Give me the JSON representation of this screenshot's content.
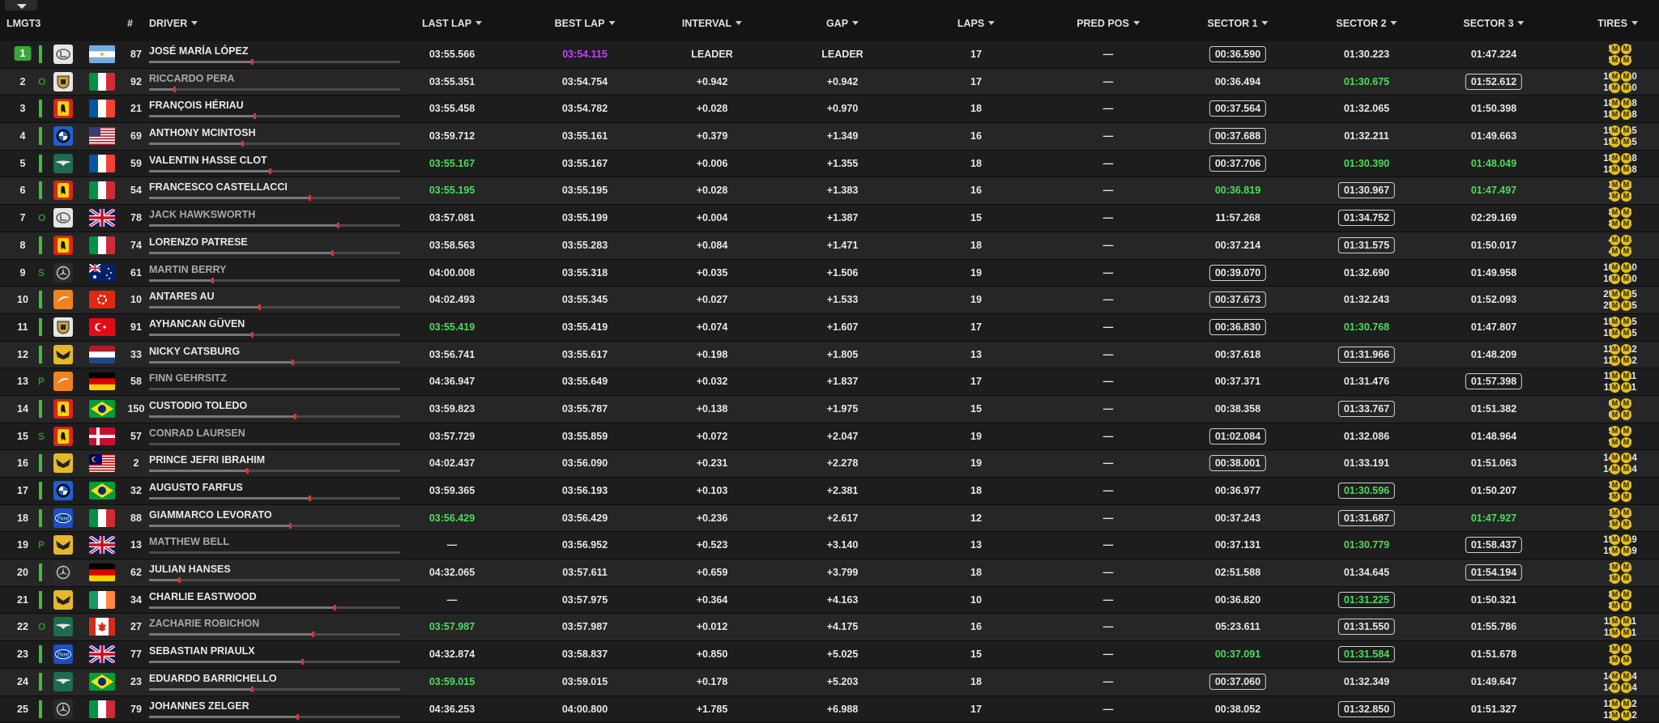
{
  "class_label": "LMGT3",
  "headers": {
    "no": "#",
    "driver": "DRIVER",
    "last_lap": "LAST LAP",
    "best_lap": "BEST LAP",
    "interval": "INTERVAL",
    "gap": "GAP",
    "laps": "LAPS",
    "pred_pos": "PRED POS",
    "sector1": "SECTOR 1",
    "sector2": "SECTOR 2",
    "sector3": "SECTOR 3",
    "tires": "TIRES"
  },
  "colors": {
    "green": "#4ddc5a",
    "purple": "#c040ff",
    "leader_badge": "#3aa63a",
    "tire": "#e8c018"
  },
  "rows": [
    {
      "pos": "1",
      "status": "",
      "brand": "lexus-icon",
      "flag": "ar",
      "no": "87",
      "driver": "JOSÉ MARÍA LÓPEZ",
      "grey": false,
      "progress": 0.41,
      "last": "03:55.566",
      "last_c": "",
      "best": "03:54.115",
      "best_c": "purple",
      "interval": "LEADER",
      "gap": "LEADER",
      "laps": "17",
      "pred": "—",
      "s1": "00:36.590",
      "s1_c": "",
      "s1_b": true,
      "s2": "01:30.223",
      "s2_c": "",
      "s2_b": false,
      "s3": "01:47.224",
      "s3_c": "",
      "s3_b": false,
      "t": [
        "5",
        "5",
        "5",
        "5"
      ]
    },
    {
      "pos": "2",
      "status": "O",
      "brand": "porsche-icon",
      "flag": "it",
      "no": "92",
      "driver": "RICCARDO PERA",
      "grey": true,
      "progress": 0.1,
      "last": "03:55.351",
      "last_c": "",
      "best": "03:54.754",
      "best_c": "",
      "interval": "+0.942",
      "gap": "+0.942",
      "laps": "17",
      "pred": "—",
      "s1": "00:36.494",
      "s1_c": "",
      "s1_b": false,
      "s2": "01:30.675",
      "s2_c": "green",
      "s2_b": false,
      "s3": "01:52.612",
      "s3_c": "",
      "s3_b": true,
      "t": [
        "10",
        "10",
        "10",
        "10"
      ]
    },
    {
      "pos": "3",
      "status": "",
      "brand": "ferrari-icon",
      "flag": "fr",
      "no": "21",
      "driver": "FRANÇOIS HÉRIAU",
      "grey": false,
      "progress": 0.42,
      "last": "03:55.458",
      "last_c": "",
      "best": "03:54.782",
      "best_c": "",
      "interval": "+0.028",
      "gap": "+0.970",
      "laps": "18",
      "pred": "—",
      "s1": "00:37.564",
      "s1_c": "",
      "s1_b": true,
      "s2": "01:32.065",
      "s2_c": "",
      "s2_b": false,
      "s3": "01:50.398",
      "s3_c": "",
      "s3_b": false,
      "t": [
        "18",
        "18",
        "18",
        "18"
      ]
    },
    {
      "pos": "4",
      "status": "",
      "brand": "bmw-icon",
      "flag": "us",
      "no": "69",
      "driver": "ANTHONY MCINTOSH",
      "grey": false,
      "progress": 0.37,
      "last": "03:59.712",
      "last_c": "",
      "best": "03:55.161",
      "best_c": "",
      "interval": "+0.379",
      "gap": "+1.349",
      "laps": "16",
      "pred": "—",
      "s1": "00:37.688",
      "s1_c": "",
      "s1_b": true,
      "s2": "01:32.211",
      "s2_c": "",
      "s2_b": false,
      "s3": "01:49.663",
      "s3_c": "",
      "s3_b": false,
      "t": [
        "15",
        "15",
        "15",
        "15"
      ]
    },
    {
      "pos": "5",
      "status": "",
      "brand": "aston-martin-icon",
      "flag": "fr",
      "no": "59",
      "driver": "VALENTIN HASSE CLOT",
      "grey": false,
      "progress": 0.48,
      "last": "03:55.167",
      "last_c": "green",
      "best": "03:55.167",
      "best_c": "",
      "interval": "+0.006",
      "gap": "+1.355",
      "laps": "18",
      "pred": "—",
      "s1": "00:37.706",
      "s1_c": "",
      "s1_b": true,
      "s2": "01:30.390",
      "s2_c": "green",
      "s2_b": false,
      "s3": "01:48.049",
      "s3_c": "green",
      "s3_b": false,
      "t": [
        "18",
        "18",
        "18",
        "18"
      ]
    },
    {
      "pos": "6",
      "status": "",
      "brand": "ferrari-icon",
      "flag": "it",
      "no": "54",
      "driver": "FRANCESCO CASTELLACCI",
      "grey": false,
      "progress": 0.64,
      "last": "03:55.195",
      "last_c": "green",
      "best": "03:55.195",
      "best_c": "",
      "interval": "+0.028",
      "gap": "+1.383",
      "laps": "16",
      "pred": "—",
      "s1": "00:36.819",
      "s1_c": "green",
      "s1_b": false,
      "s2": "01:30.967",
      "s2_c": "",
      "s2_b": true,
      "s3": "01:47.497",
      "s3_c": "green",
      "s3_b": false,
      "t": [
        "2",
        "2",
        "2",
        "2"
      ]
    },
    {
      "pos": "7",
      "status": "O",
      "brand": "lexus-icon",
      "flag": "gb",
      "no": "78",
      "driver": "JACK HAWKSWORTH",
      "grey": true,
      "progress": 0.75,
      "last": "03:57.081",
      "last_c": "",
      "best": "03:55.199",
      "best_c": "",
      "interval": "+0.004",
      "gap": "+1.387",
      "laps": "15",
      "pred": "—",
      "s1": "11:57.268",
      "s1_c": "",
      "s1_b": false,
      "s2": "01:34.752",
      "s2_c": "",
      "s2_b": true,
      "s3": "02:29.169",
      "s3_c": "",
      "s3_b": false,
      "t": [
        "8",
        "8",
        "8",
        "8"
      ]
    },
    {
      "pos": "8",
      "status": "",
      "brand": "ferrari-icon",
      "flag": "it",
      "no": "74",
      "driver": "LORENZO PATRESE",
      "grey": false,
      "progress": 0.73,
      "last": "03:58.563",
      "last_c": "",
      "best": "03:55.283",
      "best_c": "",
      "interval": "+0.084",
      "gap": "+1.471",
      "laps": "18",
      "pred": "—",
      "s1": "00:37.214",
      "s1_c": "",
      "s1_b": false,
      "s2": "01:31.575",
      "s2_c": "",
      "s2_b": true,
      "s3": "01:50.017",
      "s3_c": "",
      "s3_b": false,
      "t": [
        "4",
        "4",
        "4",
        "4"
      ]
    },
    {
      "pos": "9",
      "status": "S",
      "brand": "mercedes-icon",
      "flag": "au",
      "no": "61",
      "driver": "MARTIN BERRY",
      "grey": true,
      "progress": 0.25,
      "last": "04:00.008",
      "last_c": "",
      "best": "03:55.318",
      "best_c": "",
      "interval": "+0.035",
      "gap": "+1.506",
      "laps": "19",
      "pred": "—",
      "s1": "00:39.070",
      "s1_c": "",
      "s1_b": true,
      "s2": "01:32.690",
      "s2_c": "",
      "s2_b": false,
      "s3": "01:49.958",
      "s3_c": "",
      "s3_b": false,
      "t": [
        "10",
        "10",
        "10",
        "10"
      ]
    },
    {
      "pos": "10",
      "status": "",
      "brand": "mclaren-icon",
      "flag": "hk",
      "no": "10",
      "driver": "ANTARES AU",
      "grey": false,
      "progress": 0.44,
      "last": "04:02.493",
      "last_c": "",
      "best": "03:55.345",
      "best_c": "",
      "interval": "+0.027",
      "gap": "+1.533",
      "laps": "19",
      "pred": "—",
      "s1": "00:37.673",
      "s1_c": "",
      "s1_b": true,
      "s2": "01:32.243",
      "s2_c": "",
      "s2_b": false,
      "s3": "01:52.093",
      "s3_c": "",
      "s3_b": false,
      "t": [
        "25",
        "25",
        "25",
        "25"
      ]
    },
    {
      "pos": "11",
      "status": "",
      "brand": "porsche-icon",
      "flag": "tr",
      "no": "91",
      "driver": "AYHANCAN GÜVEN",
      "grey": false,
      "progress": 0.41,
      "last": "03:55.419",
      "last_c": "green",
      "best": "03:55.419",
      "best_c": "",
      "interval": "+0.074",
      "gap": "+1.607",
      "laps": "17",
      "pred": "—",
      "s1": "00:36.830",
      "s1_c": "",
      "s1_b": true,
      "s2": "01:30.768",
      "s2_c": "green",
      "s2_b": false,
      "s3": "01:47.807",
      "s3_c": "",
      "s3_b": false,
      "t": [
        "15",
        "15",
        "15",
        "15"
      ]
    },
    {
      "pos": "12",
      "status": "",
      "brand": "corvette-icon",
      "flag": "nl",
      "no": "33",
      "driver": "NICKY CATSBURG",
      "grey": false,
      "progress": 0.57,
      "last": "03:56.741",
      "last_c": "",
      "best": "03:55.617",
      "best_c": "",
      "interval": "+0.198",
      "gap": "+1.805",
      "laps": "13",
      "pred": "—",
      "s1": "00:37.618",
      "s1_c": "",
      "s1_b": false,
      "s2": "01:31.966",
      "s2_c": "",
      "s2_b": true,
      "s3": "01:48.209",
      "s3_c": "",
      "s3_b": false,
      "t": [
        "12",
        "12",
        "12",
        "12"
      ]
    },
    {
      "pos": "13",
      "status": "P",
      "brand": "mclaren-icon",
      "flag": "de",
      "no": "58",
      "driver": "FINN GEHRSITZ",
      "grey": true,
      "progress": 0.0,
      "last": "04:36.947",
      "last_c": "",
      "best": "03:55.649",
      "best_c": "",
      "interval": "+0.032",
      "gap": "+1.837",
      "laps": "17",
      "pred": "—",
      "s1": "00:37.371",
      "s1_c": "",
      "s1_b": false,
      "s2": "01:31.476",
      "s2_c": "",
      "s2_b": false,
      "s3": "01:57.398",
      "s3_c": "",
      "s3_b": true,
      "t": [
        "11",
        "11",
        "11",
        "11"
      ]
    },
    {
      "pos": "14",
      "status": "",
      "brand": "ferrari-icon",
      "flag": "br",
      "no": "150",
      "driver": "CUSTODIO TOLEDO",
      "grey": false,
      "progress": 0.58,
      "last": "03:59.823",
      "last_c": "",
      "best": "03:55.787",
      "best_c": "",
      "interval": "+0.138",
      "gap": "+1.975",
      "laps": "15",
      "pred": "—",
      "s1": "00:38.358",
      "s1_c": "",
      "s1_b": false,
      "s2": "01:33.767",
      "s2_c": "",
      "s2_b": true,
      "s3": "01:51.382",
      "s3_c": "",
      "s3_b": false,
      "t": [
        "6",
        "6",
        "6",
        "6"
      ]
    },
    {
      "pos": "15",
      "status": "S",
      "brand": "ferrari-icon",
      "flag": "dk",
      "no": "57",
      "driver": "CONRAD LAURSEN",
      "grey": true,
      "progress": 0.0,
      "last": "03:57.729",
      "last_c": "",
      "best": "03:55.859",
      "best_c": "",
      "interval": "+0.072",
      "gap": "+2.047",
      "laps": "19",
      "pred": "—",
      "s1": "01:02.084",
      "s1_c": "",
      "s1_b": true,
      "s2": "01:32.086",
      "s2_c": "",
      "s2_b": false,
      "s3": "01:48.964",
      "s3_c": "",
      "s3_b": false,
      "t": [
        "9",
        "9",
        "9",
        "9"
      ]
    },
    {
      "pos": "16",
      "status": "",
      "brand": "corvette-icon",
      "flag": "my",
      "no": "2",
      "driver": "PRINCE JEFRI IBRAHIM",
      "grey": false,
      "progress": 0.39,
      "last": "04:02.437",
      "last_c": "",
      "best": "03:56.090",
      "best_c": "",
      "interval": "+0.231",
      "gap": "+2.278",
      "laps": "19",
      "pred": "—",
      "s1": "00:38.001",
      "s1_c": "",
      "s1_b": true,
      "s2": "01:33.191",
      "s2_c": "",
      "s2_b": false,
      "s3": "01:51.063",
      "s3_c": "",
      "s3_b": false,
      "t": [
        "14",
        "14",
        "14",
        "14"
      ]
    },
    {
      "pos": "17",
      "status": "",
      "brand": "bmw-icon",
      "flag": "br",
      "no": "32",
      "driver": "AUGUSTO FARFUS",
      "grey": false,
      "progress": 0.64,
      "last": "03:59.365",
      "last_c": "",
      "best": "03:56.193",
      "best_c": "",
      "interval": "+0.103",
      "gap": "+2.381",
      "laps": "18",
      "pred": "—",
      "s1": "00:36.977",
      "s1_c": "",
      "s1_b": false,
      "s2": "01:30.596",
      "s2_c": "green",
      "s2_b": true,
      "s3": "01:50.207",
      "s3_c": "",
      "s3_b": false,
      "t": [
        "3",
        "3",
        "3",
        "3"
      ]
    },
    {
      "pos": "18",
      "status": "",
      "brand": "ford-icon",
      "flag": "it",
      "no": "88",
      "driver": "GIAMMARCO LEVORATO",
      "grey": false,
      "progress": 0.56,
      "last": "03:56.429",
      "last_c": "green",
      "best": "03:56.429",
      "best_c": "",
      "interval": "+0.236",
      "gap": "+2.617",
      "laps": "12",
      "pred": "—",
      "s1": "00:37.243",
      "s1_c": "",
      "s1_b": false,
      "s2": "01:31.687",
      "s2_c": "",
      "s2_b": true,
      "s3": "01:47.927",
      "s3_c": "green",
      "s3_b": false,
      "t": [
        "1",
        "1",
        "1",
        "1"
      ]
    },
    {
      "pos": "19",
      "status": "P",
      "brand": "corvette-icon",
      "flag": "gb",
      "no": "13",
      "driver": "MATTHEW BELL",
      "grey": true,
      "progress": 0.0,
      "last": "—",
      "last_c": "",
      "best": "03:56.952",
      "best_c": "",
      "interval": "+0.523",
      "gap": "+3.140",
      "laps": "13",
      "pred": "—",
      "s1": "00:37.131",
      "s1_c": "",
      "s1_b": false,
      "s2": "01:30.779",
      "s2_c": "green",
      "s2_b": false,
      "s3": "01:58.437",
      "s3_c": "",
      "s3_b": true,
      "t": [
        "19",
        "19",
        "19",
        "19"
      ]
    },
    {
      "pos": "20",
      "status": "",
      "brand": "mercedes-icon",
      "flag": "de",
      "no": "62",
      "driver": "JULIAN HANSES",
      "grey": false,
      "progress": 0.12,
      "last": "04:32.065",
      "last_c": "",
      "best": "03:57.611",
      "best_c": "",
      "interval": "+0.659",
      "gap": "+3.799",
      "laps": "18",
      "pred": "—",
      "s1": "02:51.588",
      "s1_c": "",
      "s1_b": false,
      "s2": "01:34.645",
      "s2_c": "",
      "s2_b": false,
      "s3": "01:54.194",
      "s3_c": "",
      "s3_b": true,
      "t": [
        "1",
        "1",
        "1",
        "1"
      ]
    },
    {
      "pos": "21",
      "status": "",
      "brand": "corvette-icon",
      "flag": "ie",
      "no": "34",
      "driver": "CHARLIE EASTWOOD",
      "grey": false,
      "progress": 0.74,
      "last": "—",
      "last_c": "",
      "best": "03:57.975",
      "best_c": "",
      "interval": "+0.364",
      "gap": "+4.163",
      "laps": "10",
      "pred": "—",
      "s1": "00:36.820",
      "s1_c": "",
      "s1_b": false,
      "s2": "01:31.225",
      "s2_c": "green",
      "s2_b": true,
      "s3": "01:50.321",
      "s3_c": "",
      "s3_b": false,
      "t": [
        "8",
        "8",
        "8",
        "8"
      ]
    },
    {
      "pos": "22",
      "status": "O",
      "brand": "aston-martin-icon",
      "flag": "ca",
      "no": "27",
      "driver": "ZACHARIE ROBICHON",
      "grey": true,
      "progress": 0.65,
      "last": "03:57.987",
      "last_c": "green",
      "best": "03:57.987",
      "best_c": "",
      "interval": "+0.012",
      "gap": "+4.175",
      "laps": "16",
      "pred": "—",
      "s1": "05:23.611",
      "s1_c": "",
      "s1_b": false,
      "s2": "01:31.550",
      "s2_c": "",
      "s2_b": true,
      "s3": "01:55.786",
      "s3_c": "",
      "s3_b": false,
      "t": [
        "11",
        "11",
        "11",
        "11"
      ]
    },
    {
      "pos": "23",
      "status": "",
      "brand": "ford-icon",
      "flag": "gb",
      "no": "77",
      "driver": "SEBASTIAN PRIAULX",
      "grey": false,
      "progress": 0.61,
      "last": "04:32.874",
      "last_c": "",
      "best": "03:58.837",
      "best_c": "",
      "interval": "+0.850",
      "gap": "+5.025",
      "laps": "15",
      "pred": "—",
      "s1": "00:37.091",
      "s1_c": "green",
      "s1_b": false,
      "s2": "01:31.584",
      "s2_c": "green",
      "s2_b": true,
      "s3": "01:51.678",
      "s3_c": "",
      "s3_b": false,
      "t": [
        "1",
        "1",
        "1",
        "1"
      ]
    },
    {
      "pos": "24",
      "status": "",
      "brand": "aston-martin-icon",
      "flag": "br",
      "no": "23",
      "driver": "EDUARDO BARRICHELLO",
      "grey": false,
      "progress": 0.41,
      "last": "03:59.015",
      "last_c": "green",
      "best": "03:59.015",
      "best_c": "",
      "interval": "+0.178",
      "gap": "+5.203",
      "laps": "18",
      "pred": "—",
      "s1": "00:37.060",
      "s1_c": "",
      "s1_b": true,
      "s2": "01:32.349",
      "s2_c": "",
      "s2_b": false,
      "s3": "01:49.647",
      "s3_c": "",
      "s3_b": false,
      "t": [
        "14",
        "14",
        "14",
        "14"
      ]
    },
    {
      "pos": "25",
      "status": "",
      "brand": "mercedes-icon",
      "flag": "it",
      "no": "79",
      "driver": "JOHANNES ZELGER",
      "grey": false,
      "progress": 0.59,
      "last": "04:36.253",
      "last_c": "",
      "best": "04:00.800",
      "best_c": "",
      "interval": "+1.785",
      "gap": "+6.988",
      "laps": "17",
      "pred": "—",
      "s1": "00:38.052",
      "s1_c": "",
      "s1_b": false,
      "s2": "01:32.850",
      "s2_c": "",
      "s2_b": true,
      "s3": "01:51.327",
      "s3_c": "",
      "s3_b": false,
      "t": [
        "12",
        "12",
        "12",
        "12"
      ]
    }
  ],
  "tire_compound": "M"
}
